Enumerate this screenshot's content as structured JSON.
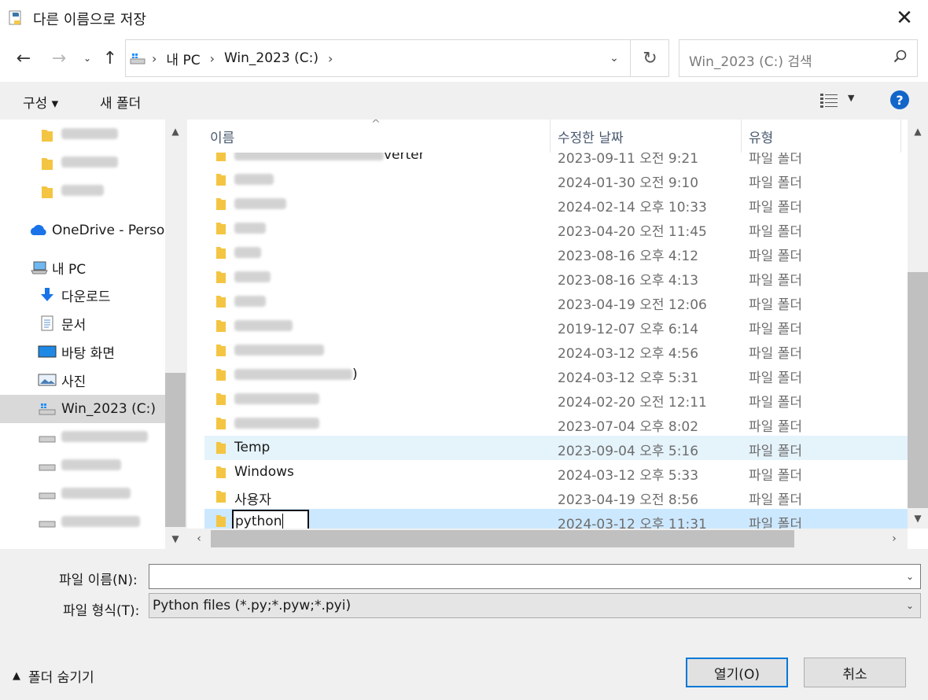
{
  "window": {
    "title": "다른 이름으로 저장",
    "close_glyph": "✕"
  },
  "address": {
    "crumbs": [
      "내 PC",
      "Win_2023 (C:)"
    ],
    "search_placeholder": "Win_2023 (C:) 검색"
  },
  "toolbar": {
    "organize_label": "구성 ▾",
    "new_folder_label": "새 폴더",
    "help_label": "?"
  },
  "nav": {
    "onedrive": "OneDrive - Person",
    "this_pc": "내 PC",
    "downloads": "다운로드",
    "documents": "문서",
    "desktop": "바탕 화면",
    "pictures": "사진",
    "drive_c": "Win_2023 (C:)"
  },
  "columns": {
    "name": "이름",
    "modified": "수정한 날짜",
    "type": "유형"
  },
  "files": [
    {
      "name": "verter",
      "date": "2023-09-11 오전 9:21",
      "type": "파일 폴더",
      "blurred": true,
      "partial": true
    },
    {
      "name": "",
      "date": "2024-01-30 오전 9:10",
      "type": "파일 폴더",
      "blurred": true
    },
    {
      "name": "",
      "date": "2024-02-14 오후 10:33",
      "type": "파일 폴더",
      "blurred": true
    },
    {
      "name": "",
      "date": "2023-04-20 오전 11:45",
      "type": "파일 폴더",
      "blurred": true
    },
    {
      "name": "",
      "date": "2023-08-16 오후 4:12",
      "type": "파일 폴더",
      "blurred": true
    },
    {
      "name": "",
      "date": "2023-08-16 오후 4:13",
      "type": "파일 폴더",
      "blurred": true
    },
    {
      "name": "",
      "date": "2023-04-19 오전 12:06",
      "type": "파일 폴더",
      "blurred": true
    },
    {
      "name": "",
      "date": "2019-12-07 오후 6:14",
      "type": "파일 폴더",
      "blurred": true
    },
    {
      "name": "",
      "date": "2024-03-12 오후 4:56",
      "type": "파일 폴더",
      "blurred": true
    },
    {
      "name": ")",
      "date": "2024-03-12 오후 5:31",
      "type": "파일 폴더",
      "blurred": true
    },
    {
      "name": "",
      "date": "2024-02-20 오전 12:11",
      "type": "파일 폴더",
      "blurred": true
    },
    {
      "name": "",
      "date": "2023-07-04 오후 8:02",
      "type": "파일 폴더",
      "blurred": true
    },
    {
      "name": "Temp",
      "date": "2023-09-04 오후 5:16",
      "type": "파일 폴더",
      "state": "hover"
    },
    {
      "name": "Windows",
      "date": "2024-03-12 오후 5:33",
      "type": "파일 폴더"
    },
    {
      "name": "사용자",
      "date": "2023-04-19 오전 8:56",
      "type": "파일 폴더"
    },
    {
      "name": "python",
      "date": "2024-03-12 오후 11:31",
      "type": "파일 폴더",
      "state": "selected",
      "renaming": true
    }
  ],
  "bottom": {
    "filename_label": "파일 이름(N):",
    "filename_value": "",
    "filetype_label": "파일 형식(T):",
    "filetype_value": "Python files (*.py;*.pyw;*.pyi)",
    "hide_folders_label": "폴더 숨기기",
    "open_label": "열기(O)",
    "cancel_label": "취소"
  },
  "colors": {
    "accent": "#0078d7",
    "selected_row": "#cce8ff",
    "hover_row": "#e5f3fb",
    "folder": "#f4c542"
  }
}
